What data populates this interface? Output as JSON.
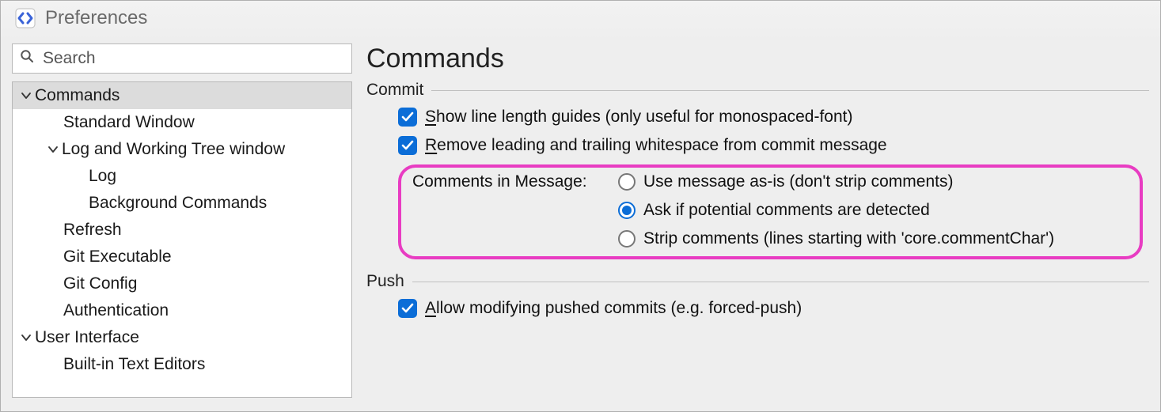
{
  "window": {
    "title": "Preferences"
  },
  "search": {
    "placeholder": "Search"
  },
  "tree": {
    "commands": "Commands",
    "standard_window": "Standard Window",
    "log_working_tree": "Log and Working Tree window",
    "log": "Log",
    "background_commands": "Background Commands",
    "refresh": "Refresh",
    "git_executable": "Git Executable",
    "git_config": "Git Config",
    "authentication": "Authentication",
    "user_interface": "User Interface",
    "builtin_text_editors": "Built-in Text Editors"
  },
  "page": {
    "title": "Commands"
  },
  "groups": {
    "commit": "Commit",
    "push": "Push"
  },
  "commit": {
    "show_guides_prefix": "S",
    "show_guides_rest": "how line length guides (only useful for monospaced-font)",
    "remove_ws_prefix": "R",
    "remove_ws_rest": "emove leading and trailing whitespace from commit message",
    "comments_label": "Comments in Message:",
    "radio_asis": "Use message as-is (don't strip comments)",
    "radio_ask": "Ask if potential comments are detected",
    "radio_strip": "Strip comments (lines starting with 'core.commentChar')"
  },
  "push": {
    "allow_modify_prefix": "A",
    "allow_modify_rest": "llow modifying pushed commits (e.g. forced-push)"
  }
}
